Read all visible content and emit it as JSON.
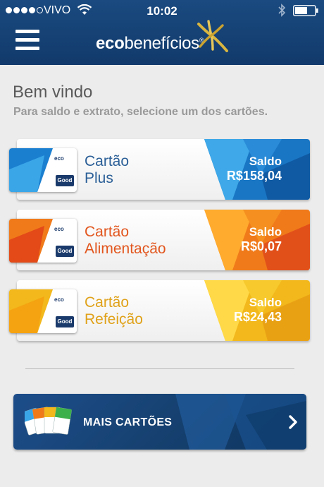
{
  "status_bar": {
    "carrier": "VIVO",
    "time": "10:02"
  },
  "brand": {
    "part1": "eco",
    "part2": "benefícios",
    "registered": "®"
  },
  "welcome": {
    "title": "Bem vindo",
    "subtitle": "Para saldo e extrato, selecione um dos cartões."
  },
  "cards": [
    {
      "name_line1": "Cartão",
      "name_line2": "Plus",
      "saldo_label": "Saldo",
      "saldo_value": "R$158,04",
      "name_color": "#2b5f97",
      "accent": "#1a78c8"
    },
    {
      "name_line1": "Cartão",
      "name_line2": "Alimentação",
      "saldo_label": "Saldo",
      "saldo_value": "R$0,07",
      "name_color": "#e2561e",
      "accent": "#f06a1a"
    },
    {
      "name_line1": "Cartão",
      "name_line2": "Refeição",
      "saldo_label": "Saldo",
      "saldo_value": "R$24,43",
      "name_color": "#e0a21a",
      "accent": "#f0b21a"
    }
  ],
  "card_thumb": {
    "eco_text": "eco",
    "good_text": "Good"
  },
  "more_button": {
    "label": "MAIS CARTÕES"
  },
  "colors": {
    "header": "#1a4a80",
    "background": "#ececec"
  },
  "icons": [
    "menu-icon",
    "wifi-icon",
    "bluetooth-icon",
    "battery-icon",
    "brand-logo-icon",
    "cards-stack-icon",
    "chevron-right-icon"
  ]
}
